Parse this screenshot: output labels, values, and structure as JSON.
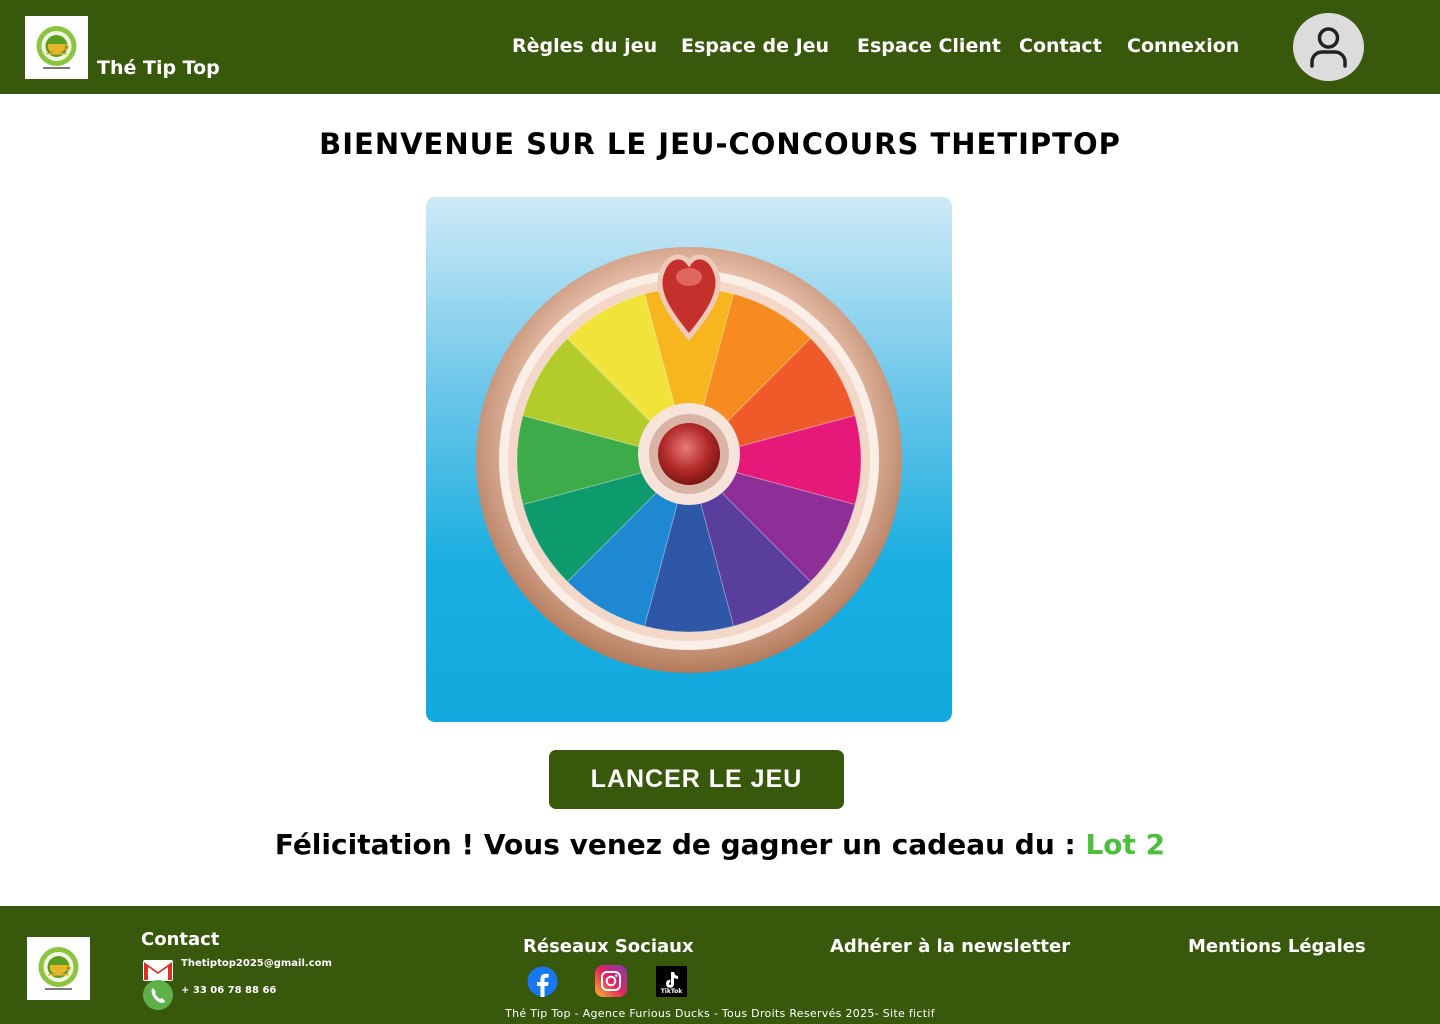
{
  "header": {
    "brand": "Thé Tip Top",
    "nav": [
      {
        "label": "Règles du jeu"
      },
      {
        "label": "Espace de Jeu"
      },
      {
        "label": "Espace Client"
      },
      {
        "label": "Contact"
      },
      {
        "label": "Connexion"
      }
    ]
  },
  "main": {
    "title": "BIENVENUE SUR LE JEU-CONCOURS THETIPTOP",
    "wheel_icon": "prize-wheel",
    "play_button": "LANCER LE JEU",
    "result_text": "Félicitation ! Vous venez de gagner un cadeau du : ",
    "result_prize": "Lot 2"
  },
  "footer": {
    "contact_heading": "Contact",
    "email": "Thetiptop2025@gmail.com",
    "phone": "+ 33 06 78 88 66",
    "social_heading": "Réseaux Sociaux",
    "social_icons": [
      "facebook-icon",
      "instagram-icon",
      "tiktok-icon"
    ],
    "tiktok_label": "TikTok",
    "newsletter": "Adhérer à la newsletter",
    "legal": "Mentions Légales",
    "copyright": "Thé Tip Top - Agence Furious Ducks - Tous Droits Reservés 2025- Site fictif"
  },
  "colors": {
    "primary_green": "#38580c",
    "accent_green": "#4cbf3c",
    "avatar_bg": "#dcdcdc"
  }
}
